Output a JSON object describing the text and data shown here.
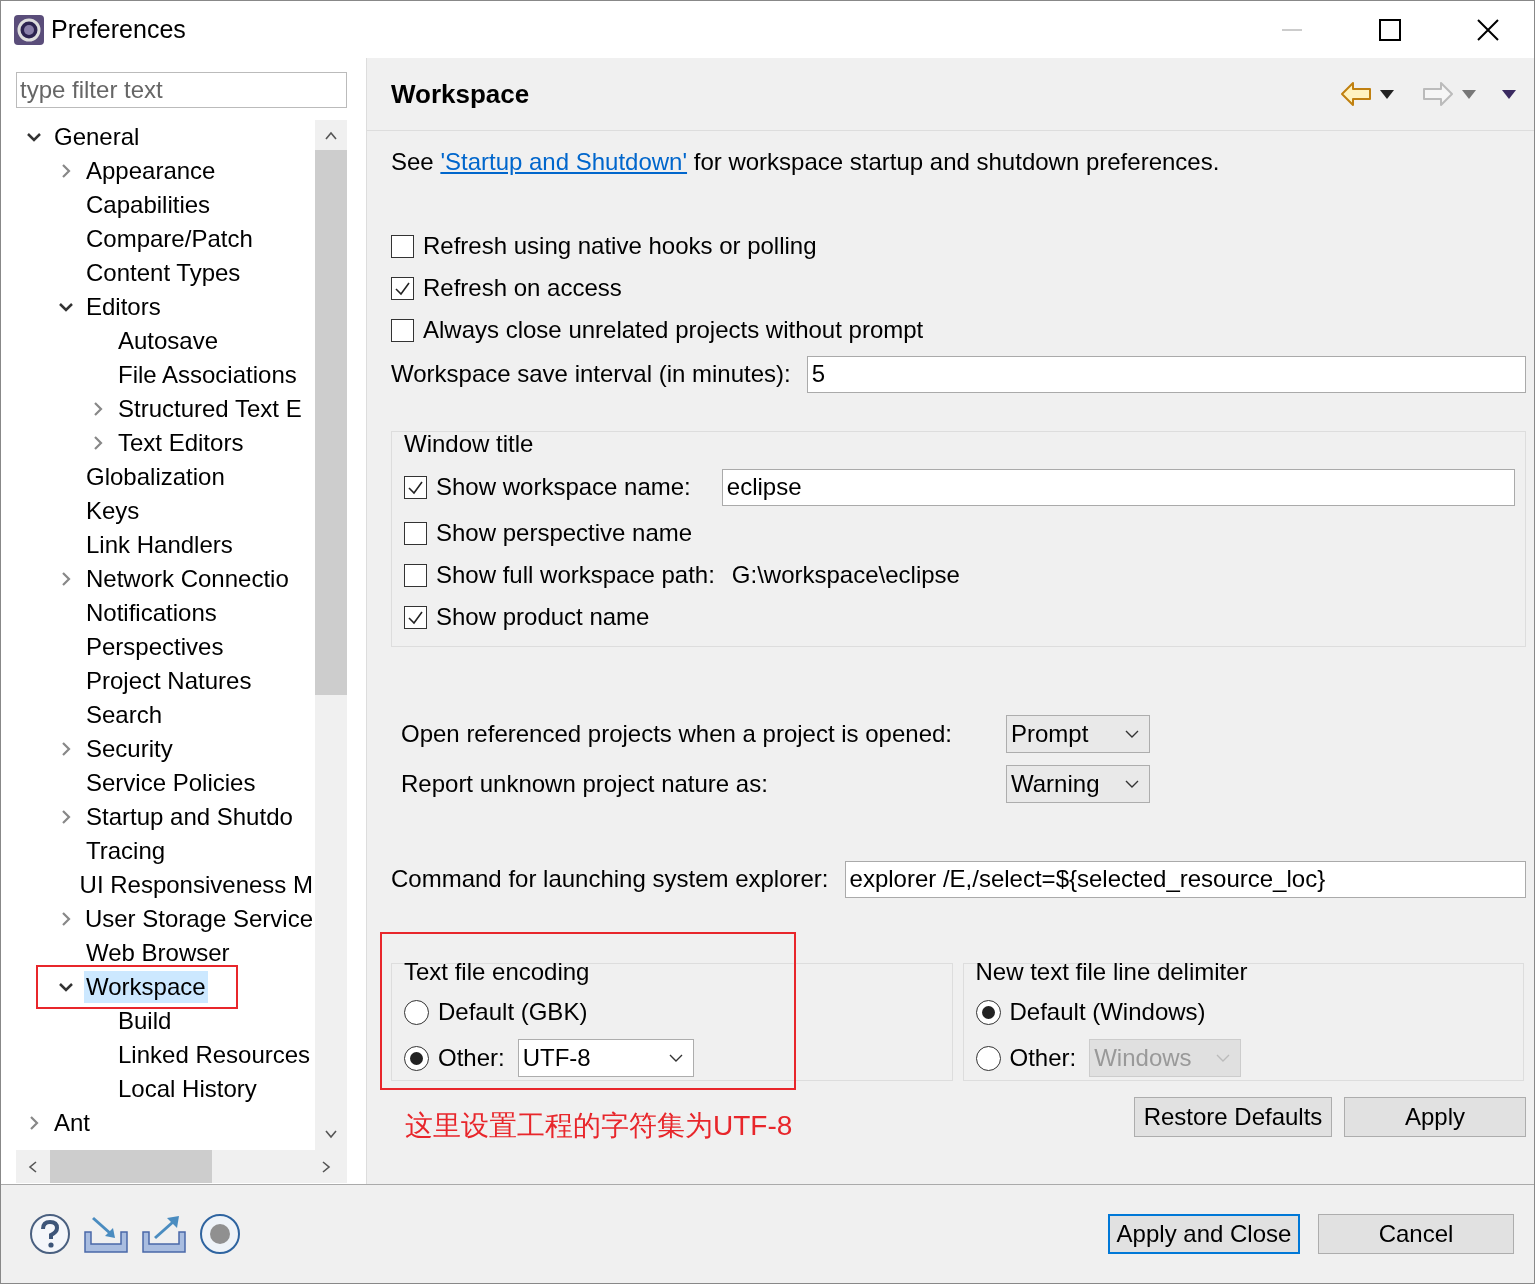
{
  "window": {
    "title": "Preferences"
  },
  "filter": {
    "placeholder": "type filter text"
  },
  "tree": [
    {
      "label": "General",
      "expanded": true,
      "selected": false,
      "children": [
        {
          "label": "Appearance",
          "expanded": false,
          "selected": false
        },
        {
          "label": "Capabilities",
          "selected": false
        },
        {
          "label": "Compare/Patch",
          "selected": false
        },
        {
          "label": "Content Types",
          "selected": false
        },
        {
          "label": "Editors",
          "expanded": true,
          "selected": false,
          "children": [
            {
              "label": "Autosave",
              "selected": false
            },
            {
              "label": "File Associations",
              "selected": false
            },
            {
              "label": "Structured Text E",
              "expanded": false,
              "selected": false
            },
            {
              "label": "Text Editors",
              "expanded": false,
              "selected": false
            }
          ]
        },
        {
          "label": "Globalization",
          "selected": false
        },
        {
          "label": "Keys",
          "selected": false
        },
        {
          "label": "Link Handlers",
          "selected": false
        },
        {
          "label": "Network Connectio",
          "expanded": false,
          "selected": false
        },
        {
          "label": "Notifications",
          "selected": false
        },
        {
          "label": "Perspectives",
          "selected": false
        },
        {
          "label": "Project Natures",
          "selected": false
        },
        {
          "label": "Search",
          "selected": false
        },
        {
          "label": "Security",
          "expanded": false,
          "selected": false
        },
        {
          "label": "Service Policies",
          "selected": false
        },
        {
          "label": "Startup and Shutdo",
          "expanded": false,
          "selected": false
        },
        {
          "label": "Tracing",
          "selected": false
        },
        {
          "label": "UI Responsiveness M",
          "selected": false
        },
        {
          "label": "User Storage Service",
          "expanded": false,
          "selected": false
        },
        {
          "label": "Web Browser",
          "selected": false
        },
        {
          "label": "Workspace",
          "expanded": true,
          "selected": true,
          "annotated": true,
          "children": [
            {
              "label": "Build",
              "selected": false
            },
            {
              "label": "Linked Resources",
              "selected": false
            },
            {
              "label": "Local History",
              "selected": false
            }
          ]
        }
      ]
    },
    {
      "label": "Ant",
      "expanded": false,
      "selected": false
    }
  ],
  "page": {
    "title": "Workspace",
    "intro": {
      "before": "See ",
      "link": "'Startup and Shutdown'",
      "after": " for workspace startup and shutdown preferences."
    },
    "checkboxes": [
      {
        "label": "Refresh using native hooks or polling",
        "checked": false
      },
      {
        "label": "Refresh on access",
        "checked": true
      },
      {
        "label": "Always close unrelated projects without prompt",
        "checked": false
      }
    ],
    "save_interval": {
      "label": "Workspace save interval (in minutes):",
      "value": "5"
    },
    "window_title": {
      "title": "Window title",
      "options": [
        {
          "kind": "field",
          "label": "Show workspace name:",
          "checked": true,
          "value": "eclipse"
        },
        {
          "kind": "plain",
          "label": "Show perspective name",
          "checked": false
        },
        {
          "kind": "path",
          "label": "Show full workspace path:",
          "checked": false,
          "path": "G:\\workspace\\eclipse"
        },
        {
          "kind": "plain",
          "label": "Show product name",
          "checked": true
        }
      ]
    },
    "dropdowns": [
      {
        "label": "Open referenced projects when a project is opened:",
        "value": "Prompt"
      },
      {
        "label": "Report unknown project nature as:",
        "value": "Warning"
      }
    ],
    "explorer": {
      "label": "Command for launching system explorer:",
      "value": "explorer /E,/select=${selected_resource_loc}"
    },
    "encoding": {
      "title": "Text file encoding",
      "annotated": true,
      "options": [
        {
          "label": "Default (GBK)",
          "selected": false
        },
        {
          "label": "Other:",
          "selected": true,
          "value": "UTF-8",
          "disabled": false
        }
      ]
    },
    "delimiter": {
      "title": "New text file line delimiter",
      "options": [
        {
          "label": "Default (Windows)",
          "selected": true
        },
        {
          "label": "Other:",
          "selected": false,
          "value": "Windows",
          "disabled": true
        }
      ]
    },
    "note": "这里设置工程的字符集为UTF-8",
    "buttons": [
      "Restore Defaults",
      "Apply"
    ]
  },
  "dialog_buttons": [
    {
      "label": "Apply and Close",
      "default": true
    },
    {
      "label": "Cancel",
      "default": false
    }
  ]
}
